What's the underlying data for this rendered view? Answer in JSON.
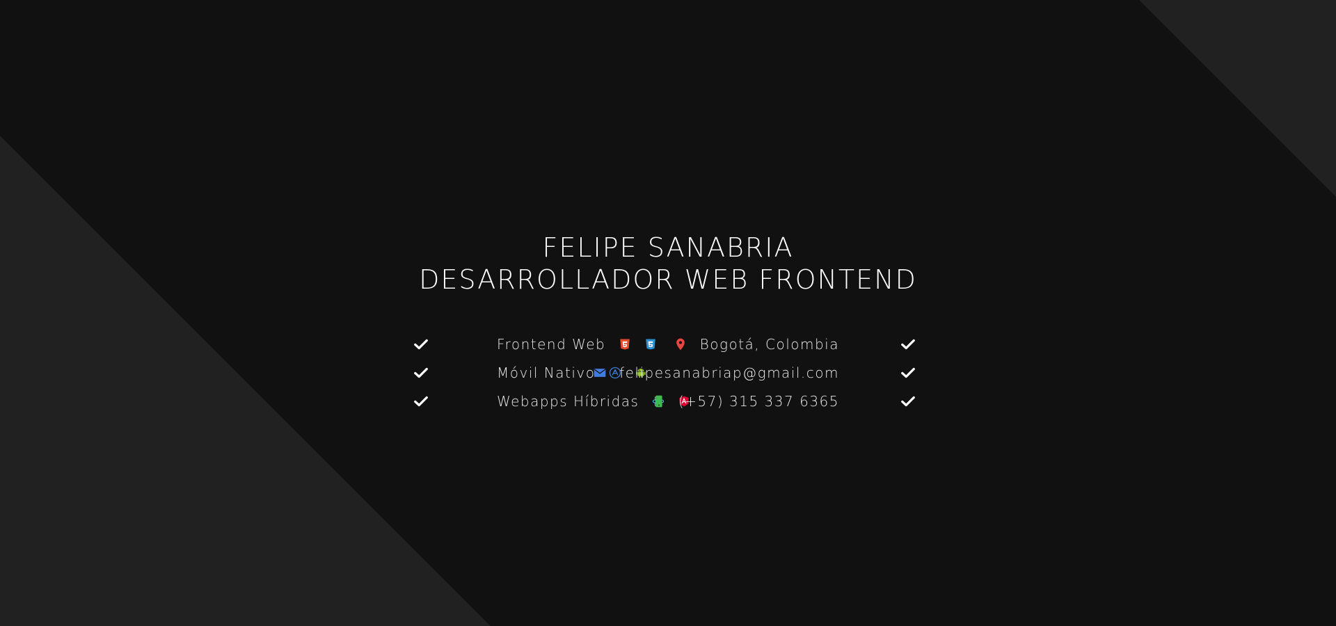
{
  "profile": {
    "name": "FELIPE SANABRIA",
    "role": "DESARROLLADOR WEB FRONTEND"
  },
  "skills": [
    {
      "label": "Frontend Web",
      "icons": [
        "html5-icon",
        "css3-icon"
      ]
    },
    {
      "label": "Móvil Nativo",
      "icons": [
        "app-store-icon",
        "android-icon"
      ]
    },
    {
      "label": "Webapps Híbridas",
      "icons": [
        "react-icon",
        "angular-icon"
      ]
    }
  ],
  "contacts": [
    {
      "label": "Bogotá, Colombia",
      "icon": "map-marker-icon"
    },
    {
      "label": "felipesanabriap@gmail.com",
      "icon": "envelope-icon"
    },
    {
      "label": "(+57) 315 337 6365",
      "icon": "mobile-phone-icon"
    }
  ],
  "colors": {
    "background": "#111111",
    "shape": "#212121",
    "html5": "#E44D26",
    "css3": "#2D8FD5",
    "app_store": "#3D7FD8",
    "android": "#9ACD32",
    "react": "#4FC8E8",
    "angular": "#DD0031",
    "marker": "#E8473E",
    "envelope": "#3F7BE0",
    "phone": "#3DBB4E"
  }
}
